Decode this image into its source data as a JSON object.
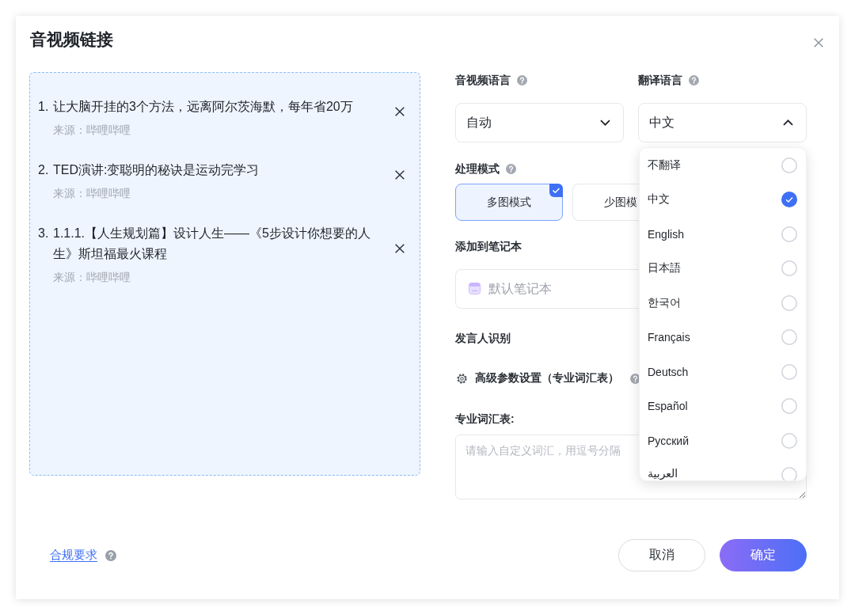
{
  "dialog": {
    "title": "音视频链接"
  },
  "links": [
    {
      "number": "1.",
      "title": "让大脑开挂的3个方法，远离阿尔茨海默，每年省20万",
      "source": "来源：哔哩哔哩"
    },
    {
      "number": "2.",
      "title": "TED演讲:变聪明的秘诀是运动完学习",
      "source": "来源：哔哩哔哩"
    },
    {
      "number": "3.",
      "title": "1.1.1.【人生规划篇】设计人生——《5步设计你想要的人生》斯坦福最火课程",
      "source": "来源：哔哩哔哩"
    }
  ],
  "settings": {
    "source_language": {
      "label": "音视频语言",
      "value": "自动",
      "expanded": false
    },
    "translation_language": {
      "label": "翻译语言",
      "value": "中文",
      "expanded": true,
      "options": [
        {
          "label": "不翻译",
          "selected": false
        },
        {
          "label": "中文",
          "selected": true
        },
        {
          "label": "English",
          "selected": false
        },
        {
          "label": "日本語",
          "selected": false
        },
        {
          "label": "한국어",
          "selected": false
        },
        {
          "label": "Français",
          "selected": false
        },
        {
          "label": "Deutsch",
          "selected": false
        },
        {
          "label": "Español",
          "selected": false
        },
        {
          "label": "Русский",
          "selected": false
        },
        {
          "label": "العربية",
          "selected": false
        }
      ]
    },
    "processing_mode": {
      "label": "处理模式",
      "options": [
        {
          "label": "多图模式",
          "selected": true
        },
        {
          "label": "少图模",
          "selected": false
        }
      ]
    },
    "notebook": {
      "label": "添加到笔记本",
      "placeholder": "默认笔记本"
    },
    "speaker_recognition": {
      "label": "发言人识别"
    },
    "advanced": {
      "label": "高级参数设置（专业词汇表）"
    },
    "glossary": {
      "label": "专业词汇表:",
      "placeholder": "请输入自定义词汇，用逗号分隔"
    }
  },
  "footer": {
    "link": "合规要求",
    "buttons": [
      {
        "label": "取消",
        "kind": "secondary"
      },
      {
        "label": "确定",
        "kind": "primary"
      }
    ]
  }
}
